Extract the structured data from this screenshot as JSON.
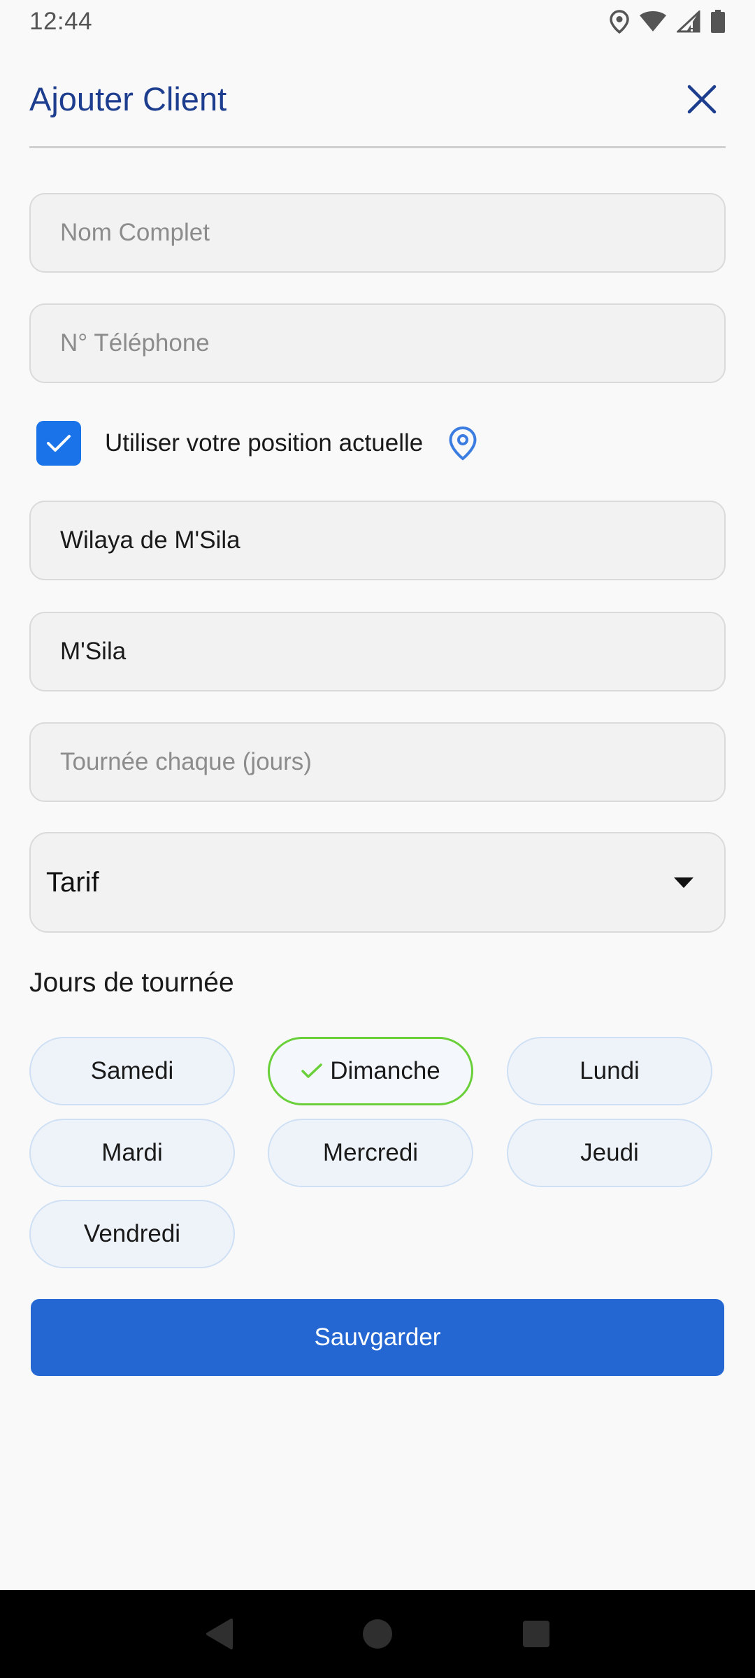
{
  "status_bar": {
    "time": "12:44",
    "icons": [
      "location-icon",
      "wifi-icon",
      "signal-icon",
      "battery-icon"
    ]
  },
  "header": {
    "title": "Ajouter Client",
    "close_icon": "close-icon"
  },
  "form": {
    "full_name": {
      "placeholder": "Nom Complet",
      "value": ""
    },
    "phone": {
      "placeholder": "N° Téléphone",
      "value": ""
    },
    "use_location": {
      "label": "Utiliser votre position actuelle",
      "checked": true
    },
    "wilaya": {
      "value": "Wilaya de M'Sila"
    },
    "commune": {
      "value": "M'Sila"
    },
    "tour_frequency": {
      "placeholder": "Tournée chaque (jours)",
      "value": ""
    },
    "tarif": {
      "value": "Tarif"
    }
  },
  "tour_days": {
    "title": "Jours de tournée",
    "days": [
      {
        "label": "Samedi",
        "selected": false
      },
      {
        "label": "Dimanche",
        "selected": true
      },
      {
        "label": "Lundi",
        "selected": false
      },
      {
        "label": "Mardi",
        "selected": false
      },
      {
        "label": "Mercredi",
        "selected": false
      },
      {
        "label": "Jeudi",
        "selected": false
      },
      {
        "label": "Vendredi",
        "selected": false
      }
    ]
  },
  "actions": {
    "save_label": "Sauvgarder"
  },
  "colors": {
    "accent": "#2467d3",
    "title": "#1d3d8f",
    "checkbox": "#1a73e8",
    "selected_chip_border": "#6ad03a",
    "location_icon": "#3b7de0"
  }
}
